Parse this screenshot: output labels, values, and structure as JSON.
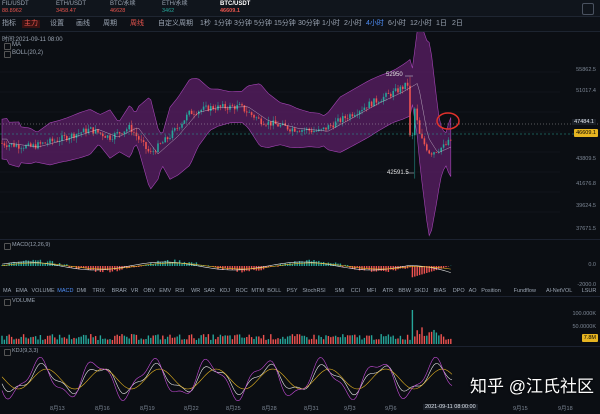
{
  "colors": {
    "up": "#26a69a",
    "down": "#ef5350",
    "accent": "#4f8ef7",
    "brand_red": "#e8554e",
    "bands": "#7b2a86",
    "price_tag": "#e6b421"
  },
  "tickers": [
    {
      "name": "FIL/USDT",
      "price": "88.8962"
    },
    {
      "name": "ETH/USDT",
      "price": "3458.47"
    },
    {
      "name": "BTC/永续",
      "price": "46628"
    },
    {
      "name": "ETH/永续",
      "price": "3462"
    },
    {
      "name": "BTC/USDT",
      "price": "46609.1"
    }
  ],
  "toolbar": {
    "items": [
      "指标",
      "主力",
      "设置",
      "画线",
      "周期",
      "周线",
      "费率",
      "自定义周期",
      "1秒",
      "1分钟",
      "3分钟",
      "5分钟",
      "15分钟",
      "30分钟",
      "1小时",
      "2小时",
      "4小时",
      "6小时",
      "12小时",
      "1日",
      "2日"
    ],
    "active_timeframe": "4小时"
  },
  "chart_header": {
    "time": "时间:2021-09-11 08:00",
    "ma": "MA",
    "boll": "BOLL(20,2)"
  },
  "price_axis": [
    "55862.5",
    "51017.4",
    "47484.1",
    "46609.1",
    "43809.5",
    "41676.8",
    "39624.5",
    "37671.5"
  ],
  "annotations": {
    "high": "52950",
    "low": "42591.5"
  },
  "price_tag": "46609.1",
  "macd": {
    "label": "MACD(12,26,9)",
    "axis": [
      "0.0",
      "-2000.0"
    ]
  },
  "indicator_tabs": [
    "MA",
    "EMA",
    "VOLUME",
    "MACD",
    "DMI",
    "TRIX",
    "BRAR",
    "VR",
    "OBV",
    "EMV",
    "RSI",
    "WR",
    "SAR",
    "KDJ",
    "ROC",
    "MTM",
    "BOLL",
    "PSY",
    "StochRSI",
    "SMI",
    "CCI",
    "MFI",
    "ATR",
    "BBW",
    "SKDJ",
    "BIAS",
    "DPO",
    "AO",
    "Position",
    "Fundflow",
    "Al-NetVOL",
    "LSUR"
  ],
  "volume": {
    "label": "VOLUME",
    "axis": [
      "100.000K",
      "50.0000K"
    ],
    "tag": "7.8M"
  },
  "kdj": {
    "label": "KDJ(9,3,3)"
  },
  "dates": [
    "8月13",
    "8月16",
    "8月19",
    "8月22",
    "8月25",
    "8月28",
    "8月31",
    "9月3",
    "9月6",
    "2021-09-11 08:00:00",
    "9月15",
    "9月18"
  ],
  "watermark": "知乎 @江氏社区",
  "chart_data": {
    "type": "candlestick",
    "ylim": [
      37671.5,
      55862.5
    ],
    "annotated_high": 52950,
    "annotated_low": 42591.5,
    "last_price": 46609.1
  }
}
